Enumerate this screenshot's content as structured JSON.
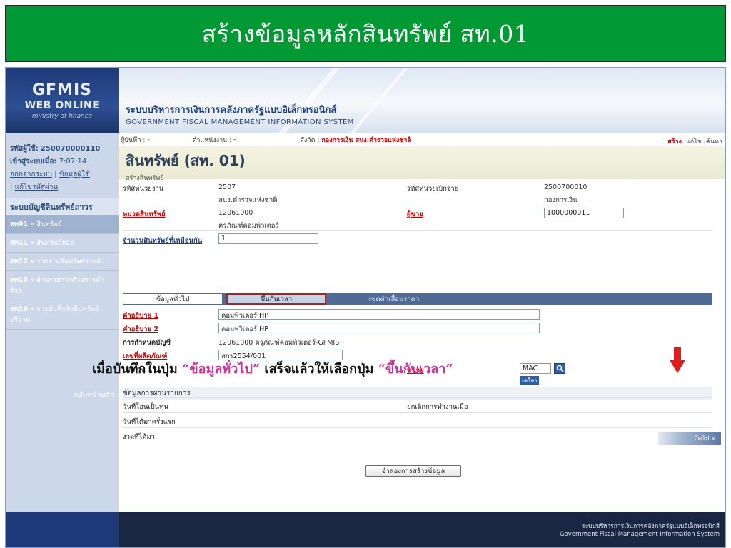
{
  "slide_title": "สร้างข้อมูลหลักสินทรัพย์ สท.01",
  "logo": {
    "line1": "GFMIS",
    "line2": "WEB ONLINE",
    "line3": "ministry of finance"
  },
  "header": {
    "thai": "ระบบบริหารการเงินการคลังภาครัฐแบบอิเล็กทรอนิกส์",
    "english": "GOVERNMENT FISCAL MANAGEMENT INFORMATION SYSTEM"
  },
  "sidebar": {
    "user_label": "รหัสผู้ใช้:",
    "user_id": "250070000110",
    "login_label": "เข้าสู่ระบบเมื่อ:",
    "login_time": "7:07:14",
    "logout_link": "ออกจากระบบ",
    "profile_link": "ข้อมูลผู้ใช้",
    "password_link": "แก้ไขรหัสผ่าน",
    "section": "ระบบบัญชีสินทรัพย์ถาวร",
    "items": [
      {
        "code": "สท01",
        "label": "สินทรัพย์"
      },
      {
        "code": "สท11",
        "label": "สินทรัพย์ย่อย"
      },
      {
        "code": "สท12",
        "label": "รายงานสินทรัพย์รายตัว"
      },
      {
        "code": "สท13",
        "label": "ผ่านรายการตัวยการหักล้าง"
      },
      {
        "code": "สท16",
        "label": "การบันทึกรับสินทรัพย์บริจาค"
      }
    ],
    "home_link": "กลับหน้าหลัก"
  },
  "crumb": {
    "recorder_label": "ผู้บันทึก :",
    "recorder_value": "-",
    "position_label": "ตำแหน่งงาน :",
    "position_value": "-",
    "affiliation_label": "สังกัด :",
    "affiliation_value": "กองการเงิน สนง.ตำรวจแห่งชาติ"
  },
  "actions": {
    "create": "สร้าง",
    "edit": "แก้ไข",
    "search": "ค้นหา"
  },
  "page": {
    "title": "สินทรัพย์ (สท. 01)",
    "subtitle": "สร้างสินทรัพย์"
  },
  "form": {
    "unit_code_label": "รหัสหน่วยงาน",
    "unit_code": "2507",
    "unit_name": "สนง.ตำรวจแห่งชาติ",
    "disb_unit_label": "รหัสหน่วยเบิกจ่าย",
    "disb_unit_code": "2500700010",
    "disb_unit_name": "กองการเงิน",
    "category_label": "หมวดสินทรัพย์",
    "category_code": "12061000",
    "category_name": "ครุภัณฑ์คอมพิวเตอร์",
    "vendor_label": "ผู้ขาย",
    "vendor_value": "1000000011",
    "qty_same_label": "จำนวนสินทรัพย์ที่เหมือนกัน",
    "qty_same_value": "1"
  },
  "tabs": {
    "general": "ข้อมูลทั่วไป",
    "time_dependent": "ขึ้นกับเวลา",
    "depreciation": "เขตค่าเสื่อมราคา"
  },
  "detail": {
    "desc1_label": "คำอธิบาย 1",
    "desc1_value": "คอมพิวเตอร์ HP",
    "desc2_label": "คำอธิบาย 2",
    "desc2_value": "คอมพวิเตอร์ HP",
    "account_label": "การกำหนดบัญชี",
    "account_value": "12061000 ครุภัณฑ์คอมพิวเตอร์-GFMIS",
    "product_no_label": "เลขที่ผลิตภัณฑ์",
    "product_no_value": "สกร2554/001",
    "quantity_label": "ปริมาณ",
    "unit_label": "หน่วย",
    "unit_value": "MAC",
    "unit_badge": "เครื่อง",
    "trans_section": "ข้อมูลการผ่านรายการ",
    "capitalize_date_label": "วันที่โอนเป็นทุน",
    "deactivation_label": "ยกเลิกการทำงานเมื่อ",
    "first_acq_label": "วันที่ได้มาครั้งแรก",
    "acq_period_label": "งวดที่ได้มา"
  },
  "next_button": "ถัดไป »",
  "simulate_button": "จำลองการสร้างข้อมูล",
  "instruction": {
    "part1": "เมื่อบันทึกในปุ่ม ",
    "part2": "“ข้อมูลทั่วไป”",
    "part3": " เสร็จแล้วให้เลือกปุ่ม ",
    "part4": "“ขึ้นกับเวลา”"
  },
  "footer": {
    "thai": "ระบบบริหารการเงินการคลังภาครัฐแบบอิเล็กทรอนิกส์",
    "english": "Government Fiscal Management Information System"
  },
  "colors": {
    "banner": "#009933",
    "sidebar": "#ccd8ea",
    "tab_bar": "#4f6a95",
    "highlight": "#b91c1c",
    "accent_pink": "#cc3399"
  }
}
